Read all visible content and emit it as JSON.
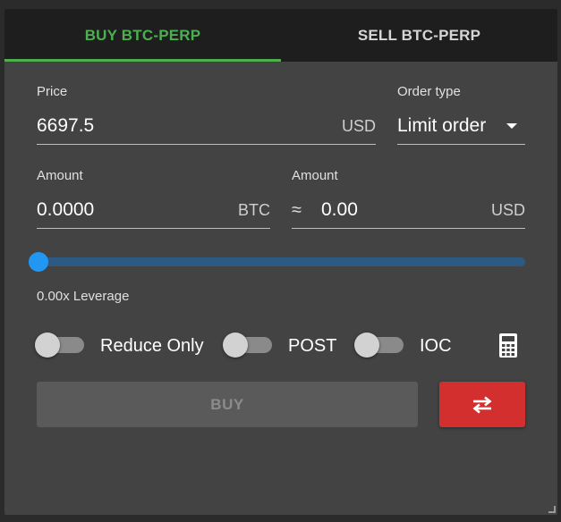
{
  "tabs": {
    "buy_label": "BUY BTC-PERP",
    "sell_label": "SELL BTC-PERP"
  },
  "price": {
    "label": "Price",
    "value": "6697.5",
    "unit": "USD"
  },
  "order_type": {
    "label": "Order type",
    "selected": "Limit order"
  },
  "amount_btc": {
    "label": "Amount",
    "value": "0.0000",
    "unit": "BTC"
  },
  "amount_usd": {
    "label": "Amount",
    "approx": "≈",
    "value": "0.00",
    "unit": "USD"
  },
  "leverage": {
    "slider_fraction": 0,
    "text": "0.00x Leverage"
  },
  "toggles": {
    "reduce_only": {
      "label": "Reduce Only",
      "on": false
    },
    "post": {
      "label": "POST",
      "on": false
    },
    "ioc": {
      "label": "IOC",
      "on": false
    }
  },
  "icons": {
    "calculator": "calculator-icon",
    "swap": "swap-arrows-icon",
    "caret": "chevron-down-icon"
  },
  "actions": {
    "buy_label": "BUY"
  },
  "colors": {
    "buy_green": "#4caf50",
    "sell_red": "#d32f2f",
    "slider_blue": "#2196f3"
  }
}
